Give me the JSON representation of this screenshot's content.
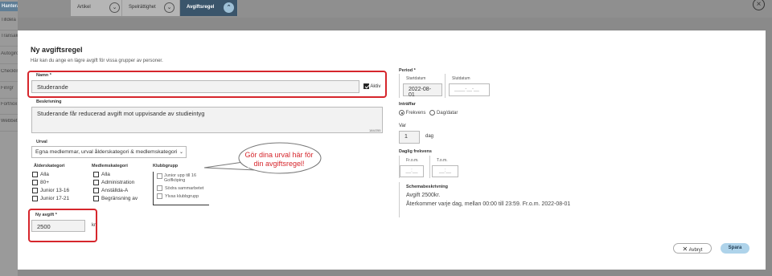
{
  "background": {
    "sidebar_header": "Hantera artikel",
    "sidebar_items": [
      "Tilldela",
      "Transakt",
      "Autogiro",
      "Checklis",
      "Finrgr",
      "Fortnox",
      "Webbet"
    ],
    "tabs": [
      {
        "label": "Artikel",
        "active": false
      },
      {
        "label": "Spelrättighet",
        "active": false
      },
      {
        "label": "Avgiftsregel",
        "active": true
      }
    ]
  },
  "modal": {
    "title": "Ny avgiftsregel",
    "subtitle": "Här kan du ange en lägre avgift för vissa grupper av personer.",
    "name": {
      "label": "Namn *",
      "value": "Studerande",
      "active_label": "Aktiv",
      "active_checked": true
    },
    "description": {
      "label": "Beskrivning",
      "value": "Studerande får reducerad avgift mot uppvisande av studieintyg",
      "counter": "184/255"
    },
    "selection": {
      "label": "Urval",
      "value": "Egna medlemmar, urval ålderskategori & medlemskategori"
    },
    "age_category": {
      "label": "Ålderskategori",
      "options": [
        "Alla",
        "80+",
        "Junior 13-16",
        "Junior 17-21"
      ]
    },
    "member_category": {
      "label": "Medlemskategori",
      "options": [
        "Alla",
        "Administration",
        "Anställda-A",
        "Begränsning av"
      ]
    },
    "club_group": {
      "label": "Klubbgrupp",
      "options": [
        "Junior upp till 16 Golfköping",
        "Södra sammarbetet",
        "Ylvas klubbgrupp"
      ]
    },
    "new_fee": {
      "label": "Ny avgift *",
      "value": "2500",
      "unit": "kr"
    },
    "period": {
      "label": "Period *",
      "start_label": "Startdatum",
      "start_value": "2022-08-01",
      "end_label": "Slutdatum",
      "end_placeholder": "____-__-__"
    },
    "occurs": {
      "label": "Inträffar",
      "frequency_label": "Frekvens",
      "day_date_label": "Dag/datar",
      "selected": "Frekvens"
    },
    "every": {
      "label": "Var",
      "value": "1",
      "unit": "dag"
    },
    "daily_frequency": {
      "label": "Daglig frekvens",
      "from_label": "Fr.o.m.",
      "to_label": "T.o.m.",
      "from_placeholder": "__:__",
      "to_placeholder": "__:__"
    },
    "schedule": {
      "label": "Schemabeskrivning",
      "line1": "Avgift 2500kr.",
      "line2": "Återkommer varje dag, mellan 00:00 till 23:59.  Fr.o.m. 2022-08-01"
    },
    "cancel_label": "Avbryt",
    "save_label": "Spara",
    "callout": "Gör dina urval här för din avgiftsregel!"
  },
  "colors": {
    "accent": "#d6262c",
    "save_button": "#aed3ea",
    "active_tab": "#3a556b"
  }
}
